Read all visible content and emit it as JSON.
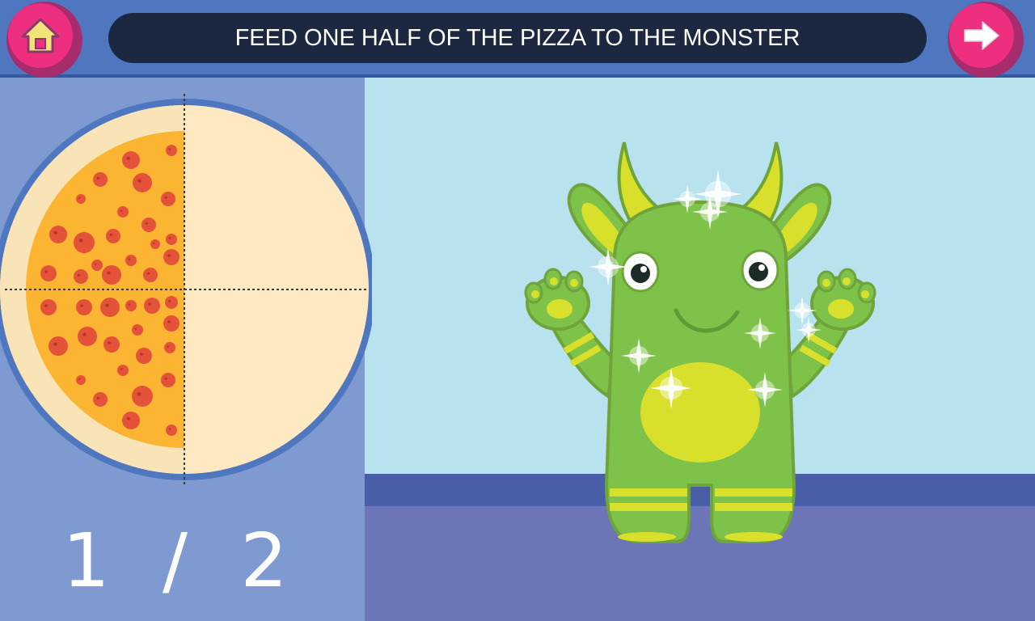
{
  "header": {
    "instruction": "FEED ONE HALF OF THE PIZZA TO THE MONSTER",
    "home_button_icon": "home-icon",
    "next_button_icon": "arrow-right-icon"
  },
  "fraction": {
    "numerator": "1",
    "denominator": "2",
    "display": "1 / 2"
  },
  "pizza": {
    "total_slices": 4,
    "remaining_slices": 2,
    "topping": "pepperoni"
  },
  "monster": {
    "color": "#7fc24a",
    "accent": "#d9e02c"
  },
  "colors": {
    "topbar": "#4f77bf",
    "button_pink": "#ee2f7f",
    "sky": "#b9e2ef",
    "floor": "#6b75b7"
  }
}
